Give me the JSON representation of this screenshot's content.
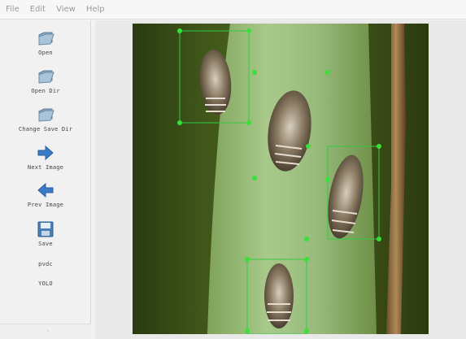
{
  "menu": [
    "File",
    "Edit",
    "View",
    "Help"
  ],
  "tools": [
    {
      "label": "Open",
      "icon": "open-folder-icon"
    },
    {
      "label": "Open Dir",
      "icon": "open-dir-icon"
    },
    {
      "label": "Change Save Dir",
      "icon": "change-save-dir-icon"
    },
    {
      "label": "Next Image",
      "icon": "next-arrow-icon"
    },
    {
      "label": "Prev Image",
      "icon": "prev-arrow-icon"
    },
    {
      "label": "Save",
      "icon": "save-icon"
    }
  ],
  "format_options": [
    "pvdc",
    "YOLO"
  ],
  "colors": {
    "box_stroke": "#2ecc40",
    "handle": "#39e03a",
    "menu_text": "#9a9a9a",
    "icon_blue": "#3a7bc8"
  }
}
